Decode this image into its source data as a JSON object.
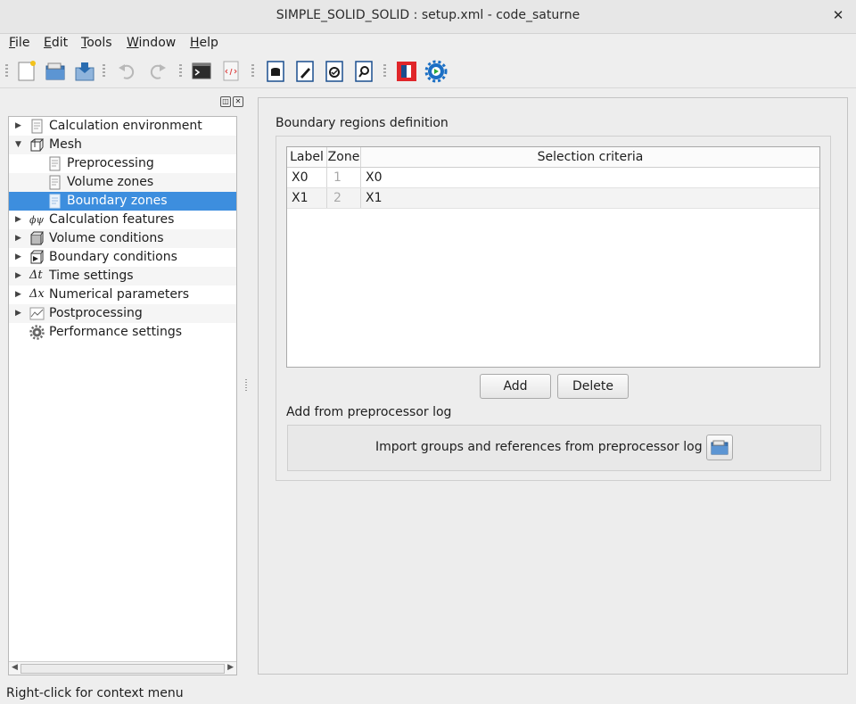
{
  "window": {
    "title": "SIMPLE_SOLID_SOLID : setup.xml - code_saturne",
    "close_glyph": "✕"
  },
  "menu": [
    {
      "label": "File",
      "accel": "F",
      "rest": "ile"
    },
    {
      "label": "Edit",
      "accel": "E",
      "rest": "dit"
    },
    {
      "label": "Tools",
      "accel": "T",
      "rest": "ools"
    },
    {
      "label": "Window",
      "accel": "W",
      "rest": "indow"
    },
    {
      "label": "Help",
      "accel": "H",
      "rest": "elp"
    }
  ],
  "toolbar": {
    "icons": [
      "new-file-icon",
      "open-file-icon",
      "save-file-icon",
      "undo-icon",
      "redo-icon",
      "terminal-icon",
      "xml-view-icon",
      "case-db-icon",
      "edit-case-icon",
      "check-case-icon",
      "search-case-icon",
      "stop-red-icon",
      "run-gear-icon"
    ]
  },
  "tree": {
    "items": [
      {
        "label": "Calculation environment",
        "expand": "▶",
        "icon": "document-icon"
      },
      {
        "label": "Mesh",
        "expand": "▼",
        "icon": "mesh-cube-icon"
      },
      {
        "label": "Preprocessing",
        "expand": "",
        "icon": "document-icon"
      },
      {
        "label": "Volume zones",
        "expand": "",
        "icon": "document-icon"
      },
      {
        "label": "Boundary zones",
        "expand": "",
        "icon": "document-icon"
      },
      {
        "label": "Calculation features",
        "expand": "▶",
        "icon": "phi-symbol-icon"
      },
      {
        "label": "Volume conditions",
        "expand": "▶",
        "icon": "volume-cube-icon"
      },
      {
        "label": "Boundary conditions",
        "expand": "▶",
        "icon": "boundary-cube-icon"
      },
      {
        "label": "Time settings",
        "expand": "▶",
        "icon": "delta-t-icon",
        "prefix": "Δt"
      },
      {
        "label": "Numerical parameters",
        "expand": "▶",
        "icon": "delta-x-icon",
        "prefix": "Δx"
      },
      {
        "label": "Postprocessing",
        "expand": "▶",
        "icon": "graph-icon"
      },
      {
        "label": "Performance settings",
        "expand": "",
        "icon": "gear-icon"
      }
    ],
    "selected_index": 4,
    "scroll_left": "◀",
    "scroll_right": "▶"
  },
  "panel": {
    "group_title": "Boundary regions definition",
    "table": {
      "headers": [
        "Label",
        "Zone",
        "Selection criteria"
      ],
      "rows": [
        {
          "label": "X0",
          "zone": "1",
          "criteria": "X0"
        },
        {
          "label": "X1",
          "zone": "2",
          "criteria": "X1"
        }
      ]
    },
    "add_button": "Add",
    "delete_button": "Delete",
    "log_section_title": "Add from preprocessor log",
    "import_text": "Import groups and references from preprocessor log"
  },
  "status": {
    "text": "Right-click for context menu"
  },
  "colors": {
    "selection": "#3d8ede",
    "run_gear": "#1b6fc4",
    "stop": "#e0262a"
  }
}
